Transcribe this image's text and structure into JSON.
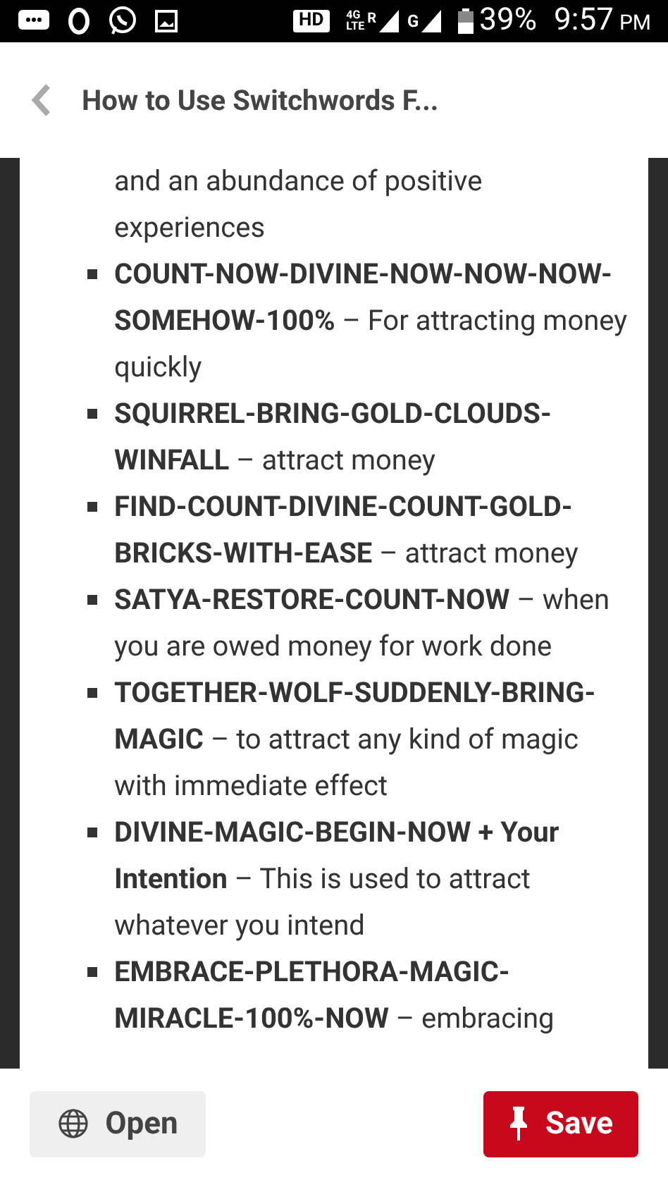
{
  "status_bar": {
    "hd": "HD",
    "network_top": "4G",
    "network_bottom": "LTE",
    "roaming": "R",
    "network_2": "G",
    "battery": "39%",
    "time": "9:57",
    "ampm": "PM"
  },
  "header": {
    "title": "How to Use Switchwords F..."
  },
  "items": [
    {
      "kind": "continuation",
      "text": "and an abundance of positive experiences"
    },
    {
      "text": "**COUNT-NOW-DIVINE-NOW-NOW-NOW-SOMEHOW-100%** – For attracting money quickly"
    },
    {
      "text": "**SQUIRREL-BRING-GOLD-CLOUDS-WINFALL** – attract money"
    },
    {
      "text": "**FIND-COUNT-DIVINE-COUNT-GOLD-BRICKS-WITH-EASE** – attract money"
    },
    {
      "text": "**SATYA-RESTORE-COUNT-NOW** – when you are owed money for work done"
    },
    {
      "text": "**TOGETHER-WOLF-SUDDENLY-BRING-MAGIC** – to attract any kind of magic with immediate effect"
    },
    {
      "text": "**DIVINE-MAGIC-BEGIN-NOW + Your Intention** – This is used to attract whatever you intend"
    },
    {
      "text": "**EMBRACE-PLETHORA-MAGIC-MIRACLE-100%-NOW** – embracing"
    }
  ],
  "buttons": {
    "open": "Open",
    "save": "Save"
  }
}
